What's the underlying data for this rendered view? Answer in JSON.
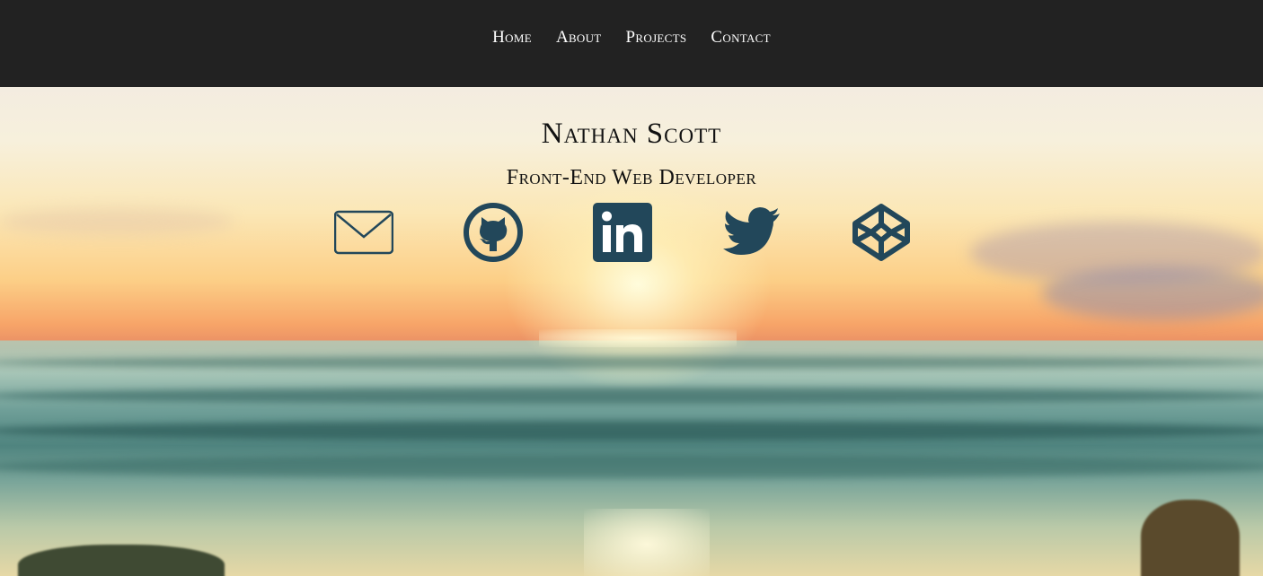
{
  "nav": {
    "items": [
      {
        "label": "Home"
      },
      {
        "label": "About"
      },
      {
        "label": "Projects"
      },
      {
        "label": "Contact"
      }
    ]
  },
  "hero": {
    "name": "Nathan Scott",
    "subtitle": "Front-End Web Developer"
  },
  "social": {
    "icon_color": "#22475a",
    "links": [
      {
        "icon": "envelope-icon"
      },
      {
        "icon": "github-icon"
      },
      {
        "icon": "linkedin-icon"
      },
      {
        "icon": "twitter-icon"
      },
      {
        "icon": "codepen-icon"
      }
    ]
  },
  "colors": {
    "navbar": "#222222",
    "nav_text": "#ffffff",
    "heading_text": "#111111"
  }
}
